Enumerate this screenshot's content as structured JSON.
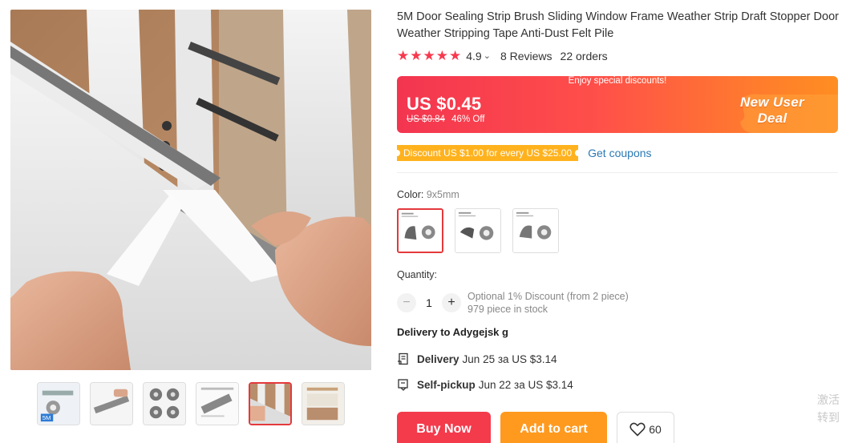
{
  "product": {
    "title": "5M Door Sealing Strip Brush Sliding Window Frame Weather Strip Draft Stopper Door Weather Stripping Tape Anti-Dust Felt Pile",
    "rating": "4.9",
    "rating_stars": 5,
    "reviews": "8 Reviews",
    "orders": "22 orders"
  },
  "gallery": {
    "active_index": 4,
    "thumbnails": [
      {
        "name": "thumb-5m-roll",
        "badge": "5M"
      },
      {
        "name": "thumb-strip-closeup"
      },
      {
        "name": "thumb-rolls-grid"
      },
      {
        "name": "thumb-size-chart"
      },
      {
        "name": "thumb-installation"
      },
      {
        "name": "thumb-window-frame"
      }
    ]
  },
  "price": {
    "banner_text": "Enjoy special discounts!",
    "current": "US $0.45",
    "original": "US $0.84",
    "discount": "46% Off",
    "deal_line1": "New User",
    "deal_line2": "Deal"
  },
  "coupon": {
    "tag": "Discount US $1.00 for every US $25.00",
    "link": "Get coupons"
  },
  "color": {
    "label": "Color:",
    "selected": "9x5mm",
    "options_count": 3
  },
  "quantity": {
    "label": "Quantity:",
    "minus": "−",
    "plus": "+",
    "value": "1",
    "info_line1": "Optional 1% Discount (from 2 piece)",
    "info_line2": "979 piece in stock"
  },
  "delivery": {
    "title": "Delivery to Adygejsk g",
    "delivery_label": "Delivery",
    "delivery_detail": "Jun 25 за US $3.14",
    "pickup_label": "Self-pickup",
    "pickup_detail": "Jun 22 за US $3.14"
  },
  "actions": {
    "buy_now": "Buy Now",
    "add_to_cart": "Add to cart",
    "wishlist_count": "60"
  },
  "watermark": {
    "line1": "激活",
    "line2": "转到"
  },
  "colors": {
    "accent_red": "#f33b4c",
    "accent_orange": "#ff9a1f",
    "link_blue": "#2a79b5",
    "coupon_yellow": "#ffb21d"
  }
}
